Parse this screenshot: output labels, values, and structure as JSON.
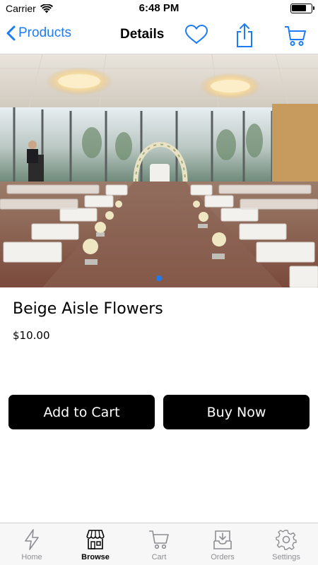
{
  "status_bar": {
    "carrier": "Carrier",
    "time": "6:48 PM",
    "battery_level": 0.75
  },
  "nav": {
    "back_label": "Products",
    "title": "Details"
  },
  "carousel": {
    "page_count": 1,
    "current_page": 1
  },
  "product": {
    "name": "Beige Aisle Flowers",
    "price": "$10.00"
  },
  "actions": {
    "add_to_cart": "Add to Cart",
    "buy_now": "Buy Now"
  },
  "tabs": [
    {
      "label": "Home",
      "icon": "lightning-icon"
    },
    {
      "label": "Browse",
      "icon": "storefront-icon",
      "active": true
    },
    {
      "label": "Cart",
      "icon": "cart-icon"
    },
    {
      "label": "Orders",
      "icon": "inbox-icon"
    },
    {
      "label": "Settings",
      "icon": "gear-icon"
    }
  ],
  "colors": {
    "accent": "#1e7cf2",
    "button": "#000000",
    "tab_inactive": "#8e8e93"
  }
}
